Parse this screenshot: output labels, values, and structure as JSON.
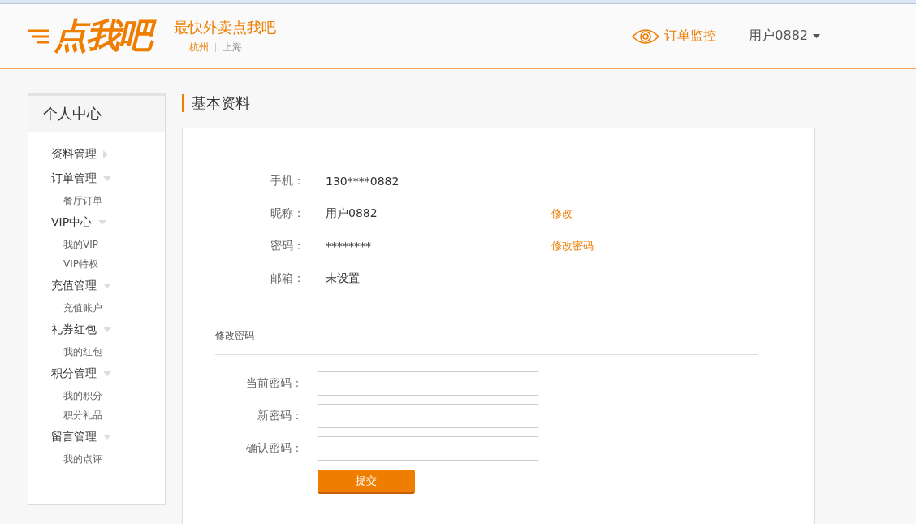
{
  "header": {
    "logo": "点我吧",
    "slogan": "最快外卖点我吧",
    "cities": [
      {
        "label": "杭州",
        "selected": true
      },
      {
        "label": "上海",
        "selected": false
      }
    ],
    "monitor_link": "订单监控",
    "user_menu": "用户0882"
  },
  "sidebar": {
    "title": "个人中心",
    "groups": [
      {
        "label": "资料管理",
        "expanded": false
      },
      {
        "label": "订单管理",
        "expanded": true,
        "children": [
          "餐厅订单"
        ]
      },
      {
        "label": "VIP中心",
        "expanded": true,
        "children": [
          "我的VIP",
          "VIP特权"
        ]
      },
      {
        "label": "充值管理",
        "expanded": true,
        "children": [
          "充值账户"
        ]
      },
      {
        "label": "礼券红包",
        "expanded": true,
        "children": [
          "我的红包"
        ]
      },
      {
        "label": "积分管理",
        "expanded": true,
        "children": [
          "我的积分",
          "积分礼品"
        ]
      },
      {
        "label": "留言管理",
        "expanded": true,
        "children": [
          "我的点评"
        ]
      }
    ]
  },
  "page_title": "基本资料",
  "profile": [
    {
      "label": "手机：",
      "value": "130****0882"
    },
    {
      "label": "昵称：",
      "value": "用户0882",
      "action": "修改"
    },
    {
      "label": "密码：",
      "value": "********",
      "action": "修改密码"
    },
    {
      "label": "邮箱：",
      "value": "未设置"
    }
  ],
  "password_form": {
    "title": "修改密码",
    "fields": [
      {
        "label": "当前密码："
      },
      {
        "label": "新密码："
      },
      {
        "label": "确认密码："
      }
    ],
    "submit": "提交"
  }
}
